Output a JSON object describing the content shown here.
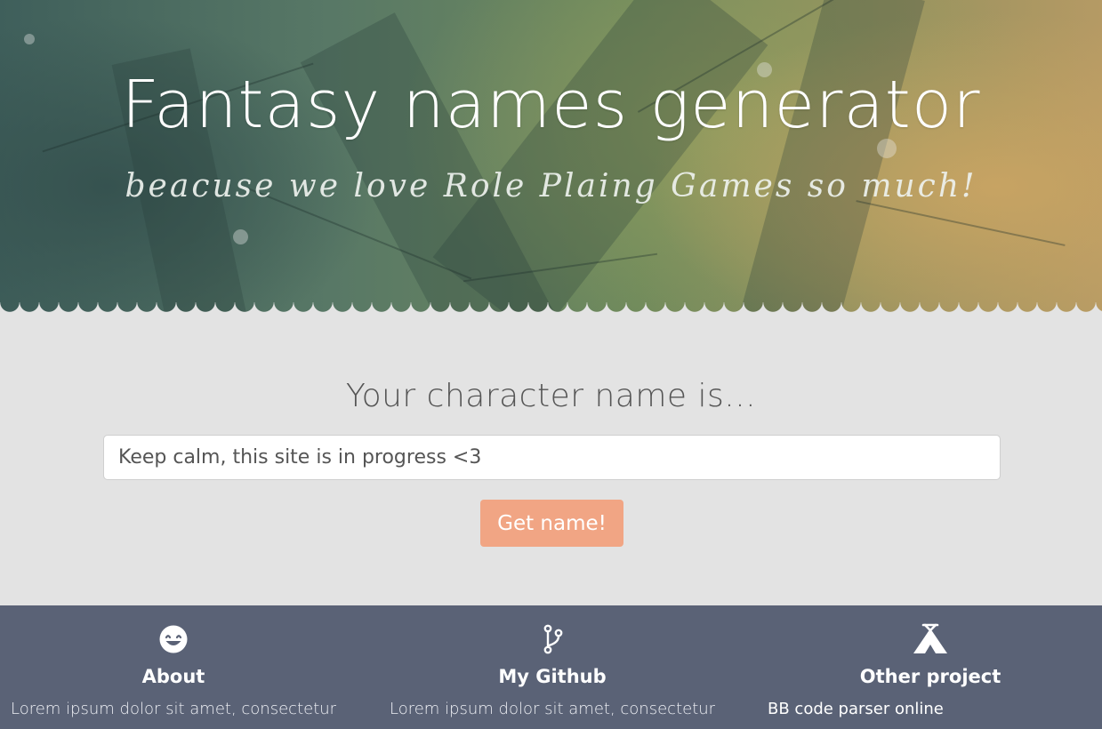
{
  "hero": {
    "title": "Fantasy names generator",
    "subtitle": "beacuse we love Role Plaing Games so much!"
  },
  "main": {
    "label": "Your character name is...",
    "input_value": "Keep calm, this site is in progress <3",
    "button_label": "Get name!"
  },
  "footer": {
    "about": {
      "icon": "smile-icon",
      "title": "About",
      "text": "Lorem ipsum dolor sit amet, consectetur"
    },
    "github": {
      "icon": "git-branch-icon",
      "title": "My Github",
      "text": "Lorem ipsum dolor sit amet, consectetur"
    },
    "other": {
      "icon": "tent-icon",
      "title": "Other project",
      "links": [
        "BB code parser online"
      ]
    }
  },
  "colors": {
    "accent": "#f1a584",
    "footer_bg": "#5a6276",
    "page_bg": "#e3e3e3"
  }
}
